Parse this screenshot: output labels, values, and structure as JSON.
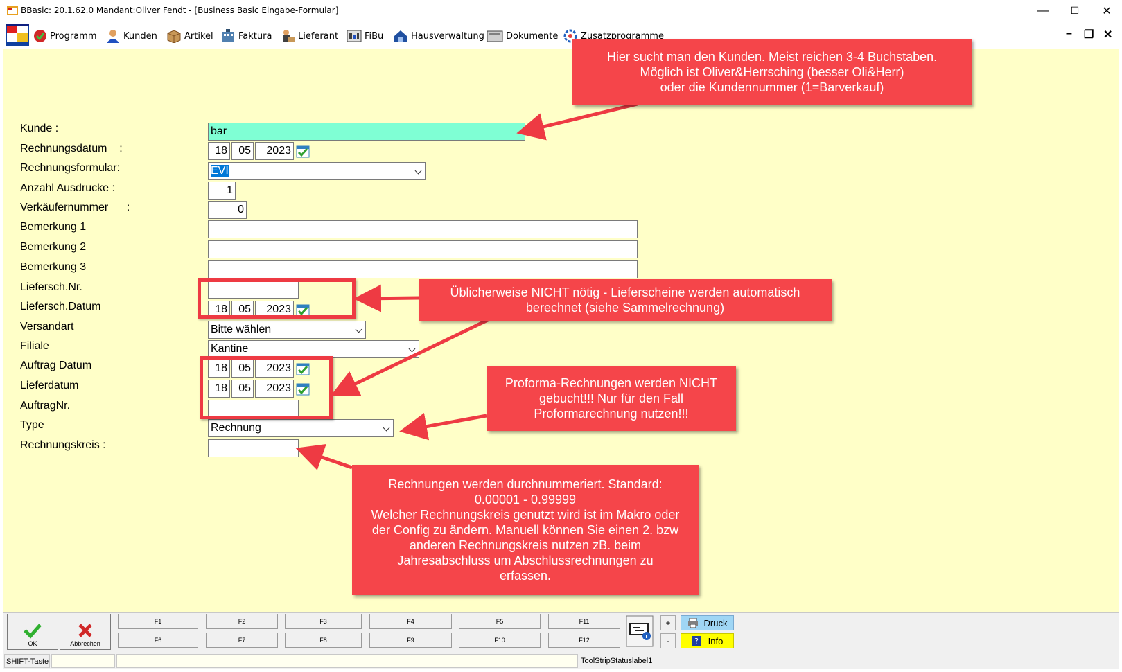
{
  "window": {
    "title": "BBasic: 20.1.62.0 Mandant:Oliver Fendt  - [Business Basic Eingabe-Formular]",
    "minimize": "—",
    "maximize": "☐",
    "close": "✕"
  },
  "menu": {
    "items": [
      "Programm",
      "Kunden",
      "Artikel",
      "Faktura",
      "Lieferant",
      "FiBu",
      "Hausverwaltung",
      "Dokumente",
      "Zusatzprogramme"
    ],
    "mdi_minimize": "–",
    "mdi_restore": "❐",
    "mdi_close": "✕"
  },
  "form": {
    "kunde": {
      "label": "Kunde :",
      "value": "bar"
    },
    "rechnungsdatum": {
      "label": "Rechnungsdatum    :",
      "day": "18",
      "month": "05",
      "year": "2023"
    },
    "rechnungsformular": {
      "label": "Rechnungsformular:",
      "value": "EVI"
    },
    "anzahl_ausdrucke": {
      "label": "Anzahl Ausdrucke :",
      "value": "1"
    },
    "verkaeufernummer": {
      "label": "Verkäufernummer      :",
      "value": "0"
    },
    "bemerkung1": {
      "label": "Bemerkung 1",
      "value": ""
    },
    "bemerkung2": {
      "label": "Bemerkung 2",
      "value": ""
    },
    "bemerkung3": {
      "label": "Bemerkung 3",
      "value": ""
    },
    "liefersch_nr": {
      "label": "Liefersch.Nr.",
      "value": ""
    },
    "liefersch_datum": {
      "label": "Liefersch.Datum",
      "day": "18",
      "month": "05",
      "year": "2023"
    },
    "versandart": {
      "label": "Versandart",
      "value": "Bitte wählen"
    },
    "filiale": {
      "label": "Filiale",
      "value": "Kantine"
    },
    "auftrag_datum": {
      "label": "Auftrag Datum",
      "day": "18",
      "month": "05",
      "year": "2023"
    },
    "lieferdatum": {
      "label": "Lieferdatum",
      "day": "18",
      "month": "05",
      "year": "2023"
    },
    "auftragnr": {
      "label": "AuftragNr.",
      "value": ""
    },
    "type": {
      "label": "Type",
      "value": "Rechnung"
    },
    "rechnungskreis": {
      "label": "Rechnungskreis :",
      "value": ""
    }
  },
  "callouts": {
    "kunde": "Hier sucht man den Kunden. Meist reichen 3-4 Buchstaben.\nMöglich ist Oliver&Herrsching (besser Oli&Herr)\noder die Kundennummer (1=Barverkauf)",
    "liefersch": "Üblicherweise NICHT nötig - Lieferscheine werden automatisch\nberechnet (siehe Sammelrechnung)",
    "proforma": "Proforma-Rechnungen werden NICHT\ngebucht!!! Nur für den Fall\nProformarechnung nutzen!!!",
    "rechnungskreis": "Rechnungen werden durchnummeriert. Standard:\n0.00001 - 0.99999\nWelcher Rechnungskreis genutzt wird ist im Makro oder\nder Config zu ändern. Manuell können Sie einen 2. bzw\nanderen Rechnungskreis nutzen zB. beim\nJahresabschluss um Abschlussrechnungen zu\nerfassen."
  },
  "toolbar": {
    "ok": "OK",
    "abbrechen": "Abbrechen",
    "fkeys_top": [
      "F1",
      "F2",
      "F3",
      "F4",
      "F5",
      "F11"
    ],
    "fkeys_bottom": [
      "F6",
      "F7",
      "F8",
      "F9",
      "F10",
      "F12"
    ],
    "plus": "+",
    "minus": "-",
    "druck": "Druck",
    "info": "Info"
  },
  "status": {
    "shift": "SHIFT-Taste",
    "label1": "ToolStripStatuslabel1"
  },
  "colors": {
    "form_bg": "#ffffc8",
    "callout": "#f5454a",
    "kunde_field": "#7fffd4",
    "druck": "#9fd6f5",
    "info": "#ffff00"
  }
}
